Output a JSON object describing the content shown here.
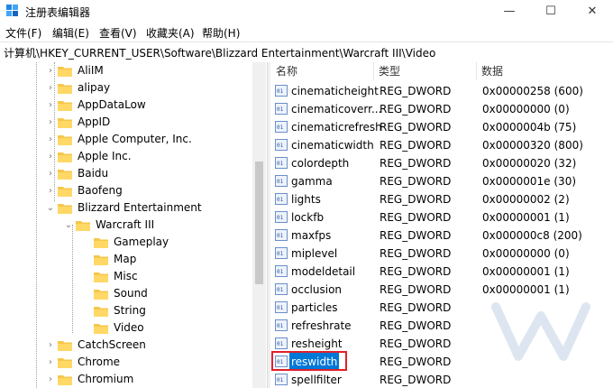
{
  "window": {
    "title": "注册表编辑器",
    "minimize_glyph": "—",
    "maximize_glyph": "☐",
    "close_glyph": "✕"
  },
  "menu": [
    "文件(F)",
    "编辑(E)",
    "查看(V)",
    "收藏夹(A)",
    "帮助(H)"
  ],
  "address": "计算机\\HKEY_CURRENT_USER\\Software\\Blizzard Entertainment\\Warcraft III\\Video",
  "tree": {
    "items": [
      {
        "label": "AliIM",
        "chevron": "›"
      },
      {
        "label": "alipay",
        "chevron": "›"
      },
      {
        "label": "AppDataLow",
        "chevron": "›"
      },
      {
        "label": "AppID",
        "chevron": "›"
      },
      {
        "label": "Apple Computer, Inc.",
        "chevron": "›"
      },
      {
        "label": "Apple Inc.",
        "chevron": "›"
      },
      {
        "label": "Baidu",
        "chevron": "›"
      },
      {
        "label": "Baofeng",
        "chevron": "›"
      },
      {
        "label": "Blizzard Entertainment",
        "chevron": "⌄"
      },
      {
        "label": "Warcraft III",
        "chevron": "⌄"
      },
      {
        "label": "Gameplay",
        "chevron": ""
      },
      {
        "label": "Map",
        "chevron": ""
      },
      {
        "label": "Misc",
        "chevron": ""
      },
      {
        "label": "Sound",
        "chevron": ""
      },
      {
        "label": "String",
        "chevron": ""
      },
      {
        "label": "Video",
        "chevron": ""
      },
      {
        "label": "CatchScreen",
        "chevron": "›"
      },
      {
        "label": "Chrome",
        "chevron": "›"
      },
      {
        "label": "Chromium",
        "chevron": "›"
      }
    ]
  },
  "list": {
    "headers": {
      "name": "名称",
      "type": "类型",
      "data": "数据"
    },
    "rows": [
      {
        "name": "cinematicheight",
        "type": "REG_DWORD",
        "data": "0x00000258 (600)"
      },
      {
        "name": "cinematicoverr...",
        "type": "REG_DWORD",
        "data": "0x00000000 (0)"
      },
      {
        "name": "cinematicrefresh",
        "type": "REG_DWORD",
        "data": "0x0000004b (75)"
      },
      {
        "name": "cinematicwidth",
        "type": "REG_DWORD",
        "data": "0x00000320 (800)"
      },
      {
        "name": "colordepth",
        "type": "REG_DWORD",
        "data": "0x00000020 (32)"
      },
      {
        "name": "gamma",
        "type": "REG_DWORD",
        "data": "0x0000001e (30)"
      },
      {
        "name": "lights",
        "type": "REG_DWORD",
        "data": "0x00000002 (2)"
      },
      {
        "name": "lockfb",
        "type": "REG_DWORD",
        "data": "0x00000001 (1)"
      },
      {
        "name": "maxfps",
        "type": "REG_DWORD",
        "data": "0x000000c8 (200)"
      },
      {
        "name": "miplevel",
        "type": "REG_DWORD",
        "data": "0x00000000 (0)"
      },
      {
        "name": "modeldetail",
        "type": "REG_DWORD",
        "data": "0x00000001 (1)"
      },
      {
        "name": "occlusion",
        "type": "REG_DWORD",
        "data": "0x00000001 (1)"
      },
      {
        "name": "particles",
        "type": "REG_DWORD",
        "data": ""
      },
      {
        "name": "refreshrate",
        "type": "REG_DWORD",
        "data": ""
      },
      {
        "name": "resheight",
        "type": "REG_DWORD",
        "data": ""
      },
      {
        "name": "reswidth",
        "type": "REG_DWORD",
        "data": ""
      },
      {
        "name": "spellfilter",
        "type": "REG_DWORD",
        "data": ""
      }
    ]
  },
  "colors": {
    "selection": "#0078d7",
    "highlight_border": "#e0202a",
    "folder": "#f5c74a"
  }
}
